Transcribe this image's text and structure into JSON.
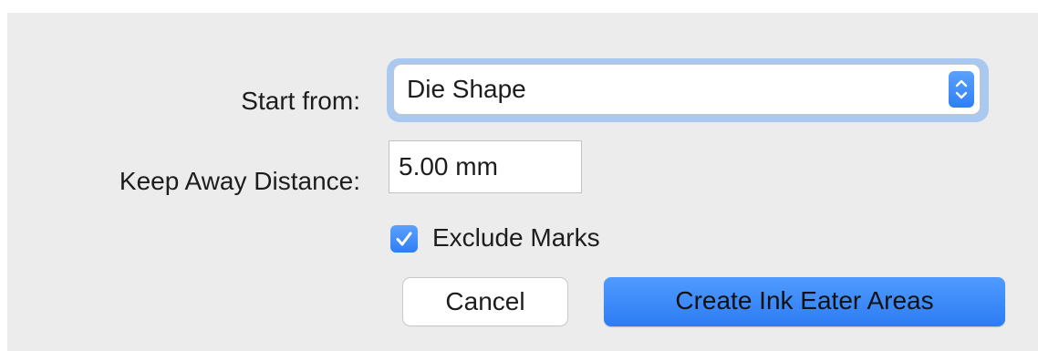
{
  "dialog": {
    "start_from": {
      "label": "Start from:",
      "value": "Die Shape",
      "stepper_icon": "chevron-up-down-icon"
    },
    "keep_away": {
      "label": "Keep Away Distance:",
      "value": "5.00 mm"
    },
    "exclude_marks": {
      "label": "Exclude Marks",
      "checked": true
    },
    "buttons": {
      "cancel": "Cancel",
      "create": "Create Ink Eater Areas"
    }
  },
  "colors": {
    "accent": "#2f7ef5",
    "focus_ring": "#a9c9f1",
    "background": "#ececec"
  }
}
